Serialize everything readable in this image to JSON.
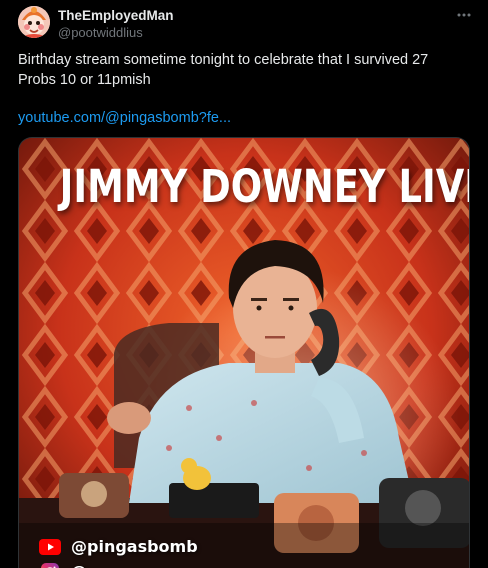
{
  "tweet": {
    "display_name": "TheEmployedMan",
    "handle": "@pootwiddlius",
    "text": "Birthday stream sometime tonight to celebrate that I survived 27\nProbs 10 or 11pmish",
    "link_text": "youtube.com/@pingasbomb?fe..."
  },
  "media": {
    "poster_title": "JIMMY DOWNEY LIVE",
    "socials": [
      {
        "icon": "youtube-icon",
        "handle": "@pingasbomb"
      },
      {
        "icon": "instagram-icon",
        "handle": "@..."
      }
    ]
  },
  "icons": {
    "more": "more-horizontal-icon"
  },
  "colors": {
    "background": "#000000",
    "text_primary": "#e7e9ea",
    "text_secondary": "#71767b",
    "link": "#1d9bf0",
    "poster_red": "#c8321a",
    "youtube_red": "#ff0000"
  }
}
